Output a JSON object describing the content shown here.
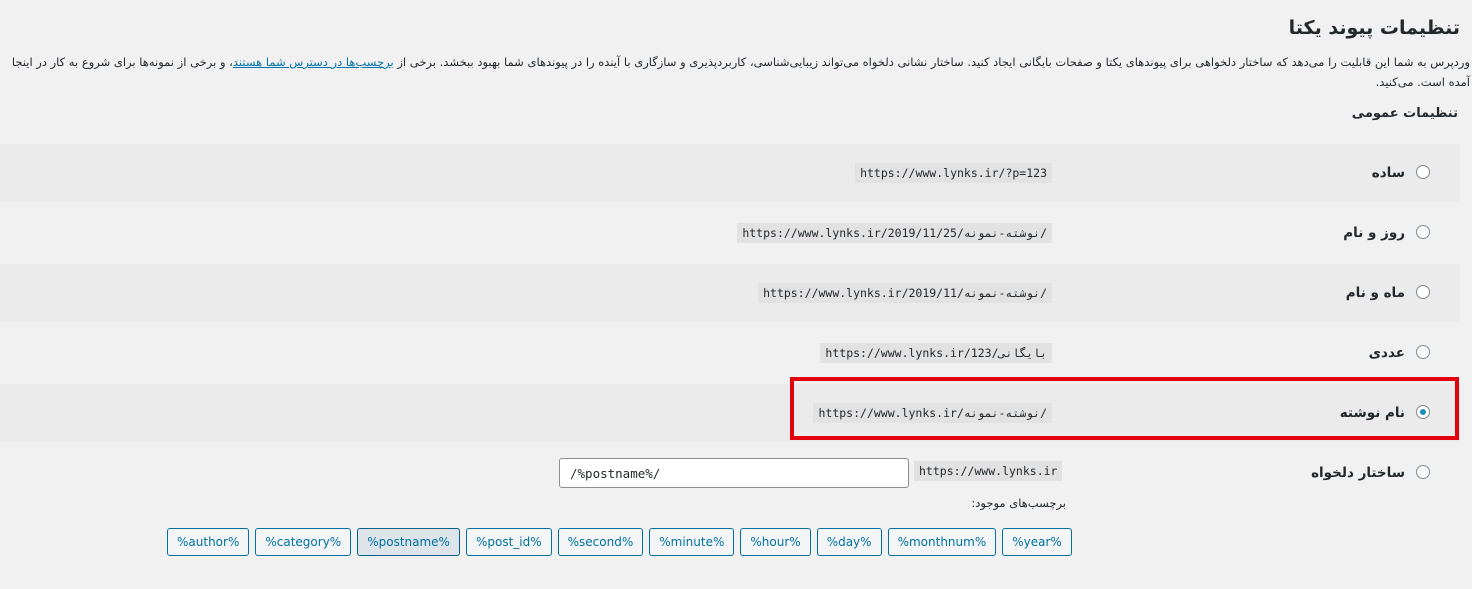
{
  "page": {
    "title": "تنظیمات پیوند یکتا",
    "description_part1": "وردپرس به شما این قابلیت را می‌دهد که ساختار دلخواهی برای پیوندهای یکتا و صفحات بایگانی ایجاد کنید. ساختار نشانی دلخواه می‌تواند زیبایی‌شناسی، کاربردپذیری و سازگاری با آینده را در پیوندهای شما بهبود ببخشد. برخی از ",
    "description_link": "برچسب‌ها در دسترس شما هستند",
    "description_part2": "، و برخی از نمونه‌ها برای شروع به کار در اینجا آمده است. می‌کنید."
  },
  "common": {
    "section_title": "تنظیمات عمومی",
    "options": [
      {
        "label": "ساده",
        "example": "https://www.lynks.ir/?p=123",
        "selected": false
      },
      {
        "label": "روز و نام",
        "example": "https://www.lynks.ir/2019/11/25/نوشته-نمونه/",
        "selected": false
      },
      {
        "label": "ماه و نام",
        "example": "https://www.lynks.ir/2019/11/نوشته-نمونه/",
        "selected": false
      },
      {
        "label": "عددی",
        "example": "https://www.lynks.ir/بایگانی/123",
        "selected": false
      },
      {
        "label": "نام نوشته",
        "example": "https://www.lynks.ir/نوشته-نمونه/",
        "selected": true
      }
    ],
    "custom": {
      "label": "ساختار دلخواه",
      "prefix": "https://www.lynks.ir",
      "value": "/%postname%/",
      "tags_label": "برچسب‌های موجود:",
      "tags": [
        "%year%",
        "%monthnum%",
        "%day%",
        "%hour%",
        "%minute%",
        "%second%",
        "%post_id%",
        "%postname%",
        "%category%",
        "%author%"
      ],
      "active_tag": "%postname%"
    }
  },
  "colors": {
    "link": "#0073aa",
    "radio_checked": "#1e8cbe",
    "highlight_box": "#e3030d",
    "tag_border": "#0071a1"
  }
}
